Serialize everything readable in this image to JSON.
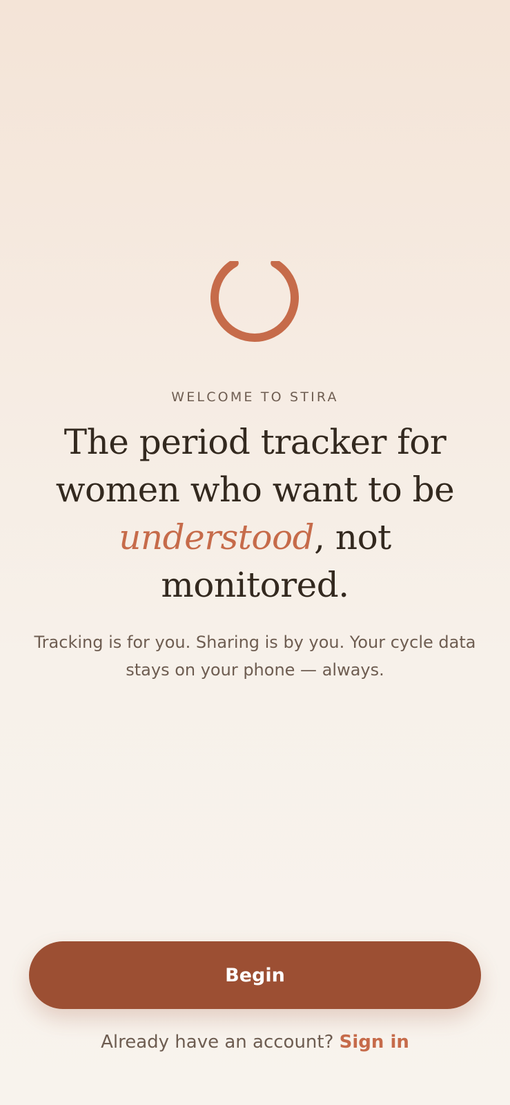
{
  "colors": {
    "brand": "#c66b4a",
    "button": "#9c4f33",
    "text_dark": "#33291f",
    "text_muted": "#6e5d51",
    "background_top": "#f4e4d7",
    "background_bottom": "#f8f3ed"
  },
  "logo": {
    "icon": "open-ring-logo-icon"
  },
  "welcome": {
    "eyebrow": "WELCOME TO STIRA",
    "headline_part1": "The period tracker for women who want to be ",
    "headline_accent": "understood",
    "headline_part2": ", not monitored.",
    "subtext": "Tracking is for you. Sharing is by you. Your cycle data stays on your phone — always."
  },
  "actions": {
    "begin_label": "Begin",
    "signin_prompt": "Already have an account?",
    "signin_label": "Sign in"
  }
}
